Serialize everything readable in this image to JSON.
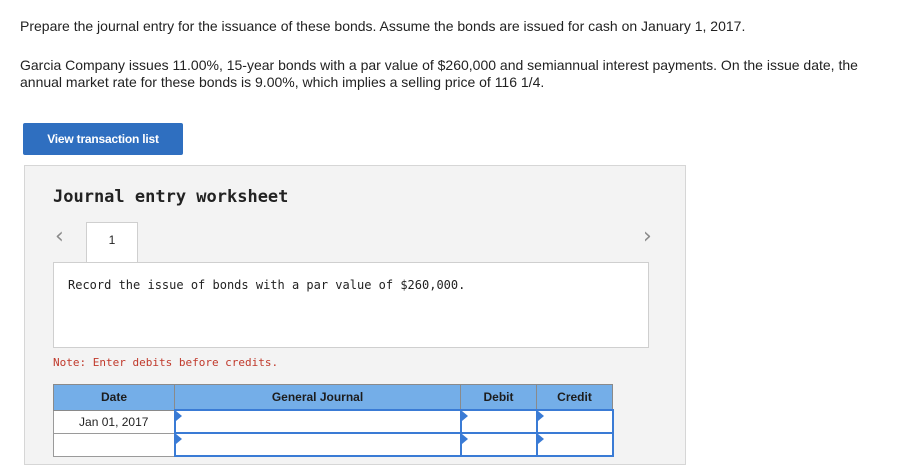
{
  "question": {
    "instruction": "Prepare the journal entry for the issuance of these bonds. Assume the bonds are issued for cash on January 1, 2017.",
    "details": "Garcia Company issues 11.00%, 15-year bonds with a par value of $260,000 and semiannual interest payments. On the issue date, the annual market rate for these bonds is 9.00%, which implies a selling price of 116 1/4."
  },
  "buttons": {
    "view_transactions": "View transaction list"
  },
  "worksheet": {
    "title": "Journal entry worksheet",
    "tab_number": "1",
    "prev_icon": "chevron-left-icon",
    "next_icon": "chevron-right-icon",
    "description": "Record the issue of bonds with a par value of $260,000.",
    "note": "Note: Enter debits before credits."
  },
  "table": {
    "headers": [
      "Date",
      "General Journal",
      "Debit",
      "Credit"
    ],
    "rows": [
      {
        "date": "Jan 01, 2017",
        "account": "",
        "debit": "",
        "credit": ""
      },
      {
        "date": "",
        "account": "",
        "debit": "",
        "credit": ""
      }
    ]
  },
  "colors": {
    "button": "#2f6fc0",
    "header": "#74aee8",
    "note": "#c0392b",
    "input_border": "#3a7bd5"
  }
}
